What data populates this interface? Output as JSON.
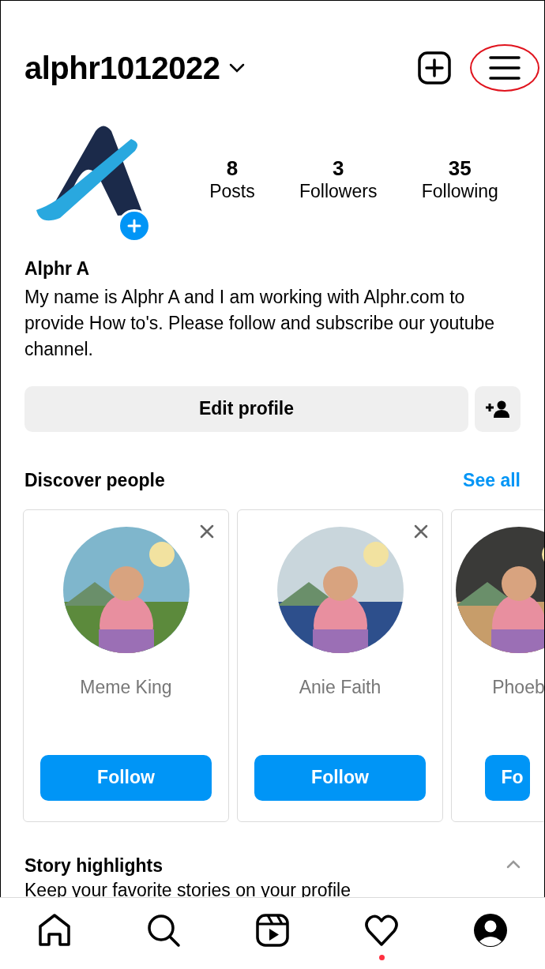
{
  "header": {
    "username": "alphr1012022",
    "menu_highlighted": true
  },
  "profile": {
    "stats": [
      {
        "value": "8",
        "label": "Posts"
      },
      {
        "value": "3",
        "label": "Followers"
      },
      {
        "value": "35",
        "label": "Following"
      }
    ],
    "name": "Alphr A",
    "bio": "My name is Alphr A and I am working with Alphr.com to provide How to's. Please follow and subscribe our youtube channel.",
    "edit_button": "Edit profile"
  },
  "discover": {
    "title": "Discover people",
    "see_all": "See all",
    "cards": [
      {
        "name": "Meme King",
        "button": "Follow",
        "dismissible": true
      },
      {
        "name": "Anie Faith",
        "button": "Follow",
        "dismissible": true
      },
      {
        "name": "Phoeb",
        "button": "Fo",
        "dismissible": false
      }
    ]
  },
  "highlights": {
    "title": "Story highlights",
    "subtitle": "Keep your favorite stories on your profile",
    "expanded": true
  },
  "nav": [
    {
      "kind": "home",
      "selected": false,
      "notification": false
    },
    {
      "kind": "search",
      "selected": false,
      "notification": false
    },
    {
      "kind": "reels",
      "selected": false,
      "notification": false
    },
    {
      "kind": "heart",
      "selected": false,
      "notification": true
    },
    {
      "kind": "profile",
      "selected": true,
      "notification": false
    }
  ]
}
